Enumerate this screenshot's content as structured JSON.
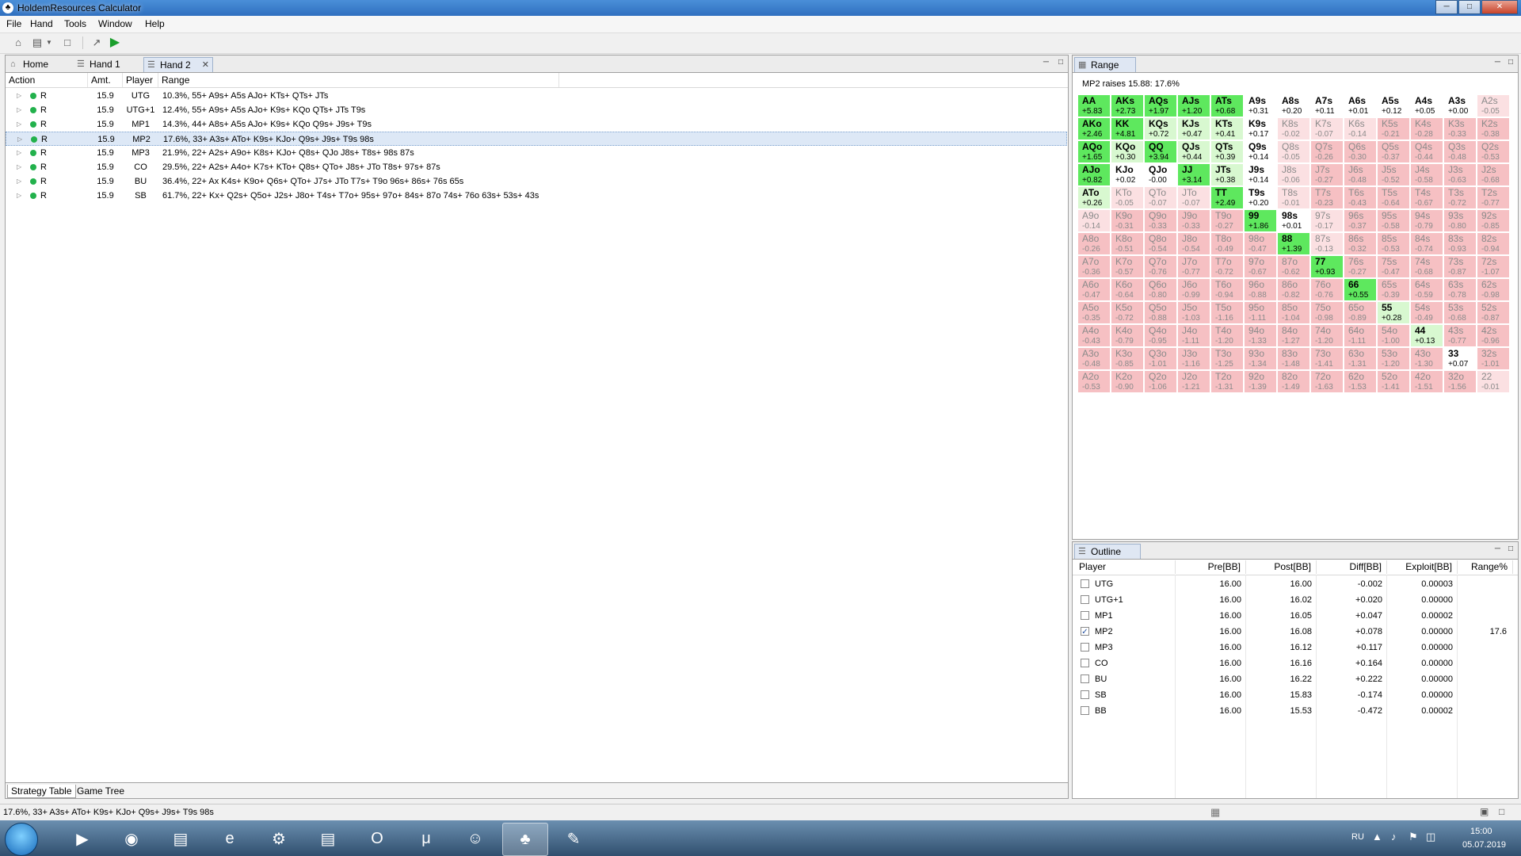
{
  "window": {
    "title": "HoldemResources Calculator"
  },
  "menu": [
    "File",
    "Hand",
    "Tools",
    "Window",
    "Help"
  ],
  "colors": {
    "selected_row": "#dde8f6",
    "green_strong": "#5ee85e",
    "green_light": "#d8f8d0",
    "red": "#f6c0c3",
    "pink_light": "#fbe0e2",
    "status_dot": "#22b14c"
  },
  "tabs": {
    "home": "Home",
    "hand1": "Hand 1",
    "hand2": "Hand 2"
  },
  "strategy": {
    "headers": [
      "Action",
      "Amt.",
      "Player",
      "Range"
    ],
    "rows": [
      {
        "action": "R",
        "amt": "15.9",
        "player": "UTG",
        "range": "10.3%, 55+ A9s+ A5s AJo+ KTs+ QTs+ JTs"
      },
      {
        "action": "R",
        "amt": "15.9",
        "player": "UTG+1",
        "range": "12.4%, 55+ A9s+ A5s AJo+ K9s+ KQo QTs+ JTs T9s"
      },
      {
        "action": "R",
        "amt": "15.9",
        "player": "MP1",
        "range": "14.3%, 44+ A8s+ A5s AJo+ K9s+ KQo Q9s+ J9s+ T9s"
      },
      {
        "action": "R",
        "amt": "15.9",
        "player": "MP2",
        "range": "17.6%, 33+ A3s+ ATo+ K9s+ KJo+ Q9s+ J9s+ T9s 98s"
      },
      {
        "action": "R",
        "amt": "15.9",
        "player": "MP3",
        "range": "21.9%, 22+ A2s+ A9o+ K8s+ KJo+ Q8s+ QJo J8s+ T8s+ 98s 87s"
      },
      {
        "action": "R",
        "amt": "15.9",
        "player": "CO",
        "range": "29.5%, 22+ A2s+ A4o+ K7s+ KTo+ Q8s+ QTo+ J8s+ JTo T8s+ 97s+ 87s"
      },
      {
        "action": "R",
        "amt": "15.9",
        "player": "BU",
        "range": "36.4%, 22+ Ax K4s+ K9o+ Q6s+ QTo+ J7s+ JTo T7s+ T9o 96s+ 86s+ 76s 65s"
      },
      {
        "action": "R",
        "amt": "15.9",
        "player": "SB",
        "range": "61.7%, 22+ Kx+ Q2s+ Q5o+ J2s+ J8o+ T4s+ T7o+ 95s+ 97o+ 84s+ 87o 74s+ 76o 63s+ 53s+ 43s"
      }
    ],
    "bottom_tabs": [
      "Strategy Table",
      "Game Tree"
    ]
  },
  "range_panel": {
    "tab": "Range",
    "info": "MP2 raises 15.88: 17.6%",
    "grid": [
      [
        [
          "AA",
          "+5.83",
          "G"
        ],
        [
          "AKs",
          "+2.73",
          "G"
        ],
        [
          "AQs",
          "+1.97",
          "G"
        ],
        [
          "AJs",
          "+1.20",
          "G"
        ],
        [
          "ATs",
          "+0.68",
          "G"
        ],
        [
          "A9s",
          "+0.31",
          "W"
        ],
        [
          "A8s",
          "+0.20",
          "W"
        ],
        [
          "A7s",
          "+0.11",
          "W"
        ],
        [
          "A6s",
          "+0.01",
          "W"
        ],
        [
          "A5s",
          "+0.12",
          "W"
        ],
        [
          "A4s",
          "+0.05",
          "W"
        ],
        [
          "A3s",
          "+0.00",
          "W"
        ],
        [
          "A2s",
          "-0.05",
          "P"
        ]
      ],
      [
        [
          "AKo",
          "+2.46",
          "G"
        ],
        [
          "KK",
          "+4.81",
          "G"
        ],
        [
          "KQs",
          "+0.72",
          "L"
        ],
        [
          "KJs",
          "+0.47",
          "L"
        ],
        [
          "KTs",
          "+0.41",
          "L"
        ],
        [
          "K9s",
          "+0.17",
          "W"
        ],
        [
          "K8s",
          "-0.02",
          "P"
        ],
        [
          "K7s",
          "-0.07",
          "P"
        ],
        [
          "K6s",
          "-0.14",
          "P"
        ],
        [
          "K5s",
          "-0.21",
          "R"
        ],
        [
          "K4s",
          "-0.28",
          "R"
        ],
        [
          "K3s",
          "-0.33",
          "R"
        ],
        [
          "K2s",
          "-0.38",
          "R"
        ]
      ],
      [
        [
          "AQo",
          "+1.65",
          "G"
        ],
        [
          "KQo",
          "+0.30",
          "L"
        ],
        [
          "QQ",
          "+3.94",
          "G"
        ],
        [
          "QJs",
          "+0.44",
          "L"
        ],
        [
          "QTs",
          "+0.39",
          "L"
        ],
        [
          "Q9s",
          "+0.14",
          "W"
        ],
        [
          "Q8s",
          "-0.05",
          "P"
        ],
        [
          "Q7s",
          "-0.26",
          "R"
        ],
        [
          "Q6s",
          "-0.30",
          "R"
        ],
        [
          "Q5s",
          "-0.37",
          "R"
        ],
        [
          "Q4s",
          "-0.44",
          "R"
        ],
        [
          "Q3s",
          "-0.48",
          "R"
        ],
        [
          "Q2s",
          "-0.53",
          "R"
        ]
      ],
      [
        [
          "AJo",
          "+0.82",
          "G"
        ],
        [
          "KJo",
          "+0.02",
          "W"
        ],
        [
          "QJo",
          "-0.00",
          "W"
        ],
        [
          "JJ",
          "+3.14",
          "G"
        ],
        [
          "JTs",
          "+0.38",
          "L"
        ],
        [
          "J9s",
          "+0.14",
          "W"
        ],
        [
          "J8s",
          "-0.06",
          "P"
        ],
        [
          "J7s",
          "-0.27",
          "R"
        ],
        [
          "J6s",
          "-0.48",
          "R"
        ],
        [
          "J5s",
          "-0.52",
          "R"
        ],
        [
          "J4s",
          "-0.58",
          "R"
        ],
        [
          "J3s",
          "-0.63",
          "R"
        ],
        [
          "J2s",
          "-0.68",
          "R"
        ]
      ],
      [
        [
          "ATo",
          "+0.26",
          "L"
        ],
        [
          "KTo",
          "-0.05",
          "P"
        ],
        [
          "QTo",
          "-0.07",
          "P"
        ],
        [
          "JTo",
          "-0.07",
          "P"
        ],
        [
          "TT",
          "+2.49",
          "G"
        ],
        [
          "T9s",
          "+0.20",
          "W"
        ],
        [
          "T8s",
          "-0.01",
          "P"
        ],
        [
          "T7s",
          "-0.23",
          "R"
        ],
        [
          "T6s",
          "-0.43",
          "R"
        ],
        [
          "T5s",
          "-0.64",
          "R"
        ],
        [
          "T4s",
          "-0.67",
          "R"
        ],
        [
          "T3s",
          "-0.72",
          "R"
        ],
        [
          "T2s",
          "-0.77",
          "R"
        ]
      ],
      [
        [
          "A9o",
          "-0.14",
          "P"
        ],
        [
          "K9o",
          "-0.31",
          "R"
        ],
        [
          "Q9o",
          "-0.33",
          "R"
        ],
        [
          "J9o",
          "-0.33",
          "R"
        ],
        [
          "T9o",
          "-0.27",
          "R"
        ],
        [
          "99",
          "+1.86",
          "G"
        ],
        [
          "98s",
          "+0.01",
          "W"
        ],
        [
          "97s",
          "-0.17",
          "P"
        ],
        [
          "96s",
          "-0.37",
          "R"
        ],
        [
          "95s",
          "-0.58",
          "R"
        ],
        [
          "94s",
          "-0.79",
          "R"
        ],
        [
          "93s",
          "-0.80",
          "R"
        ],
        [
          "92s",
          "-0.85",
          "R"
        ]
      ],
      [
        [
          "A8o",
          "-0.26",
          "R"
        ],
        [
          "K8o",
          "-0.51",
          "R"
        ],
        [
          "Q8o",
          "-0.54",
          "R"
        ],
        [
          "J8o",
          "-0.54",
          "R"
        ],
        [
          "T8o",
          "-0.49",
          "R"
        ],
        [
          "98o",
          "-0.47",
          "R"
        ],
        [
          "88",
          "+1.39",
          "G"
        ],
        [
          "87s",
          "-0.13",
          "P"
        ],
        [
          "86s",
          "-0.32",
          "R"
        ],
        [
          "85s",
          "-0.53",
          "R"
        ],
        [
          "84s",
          "-0.74",
          "R"
        ],
        [
          "83s",
          "-0.93",
          "R"
        ],
        [
          "82s",
          "-0.94",
          "R"
        ]
      ],
      [
        [
          "A7o",
          "-0.36",
          "R"
        ],
        [
          "K7o",
          "-0.57",
          "R"
        ],
        [
          "Q7o",
          "-0.76",
          "R"
        ],
        [
          "J7o",
          "-0.77",
          "R"
        ],
        [
          "T7o",
          "-0.72",
          "R"
        ],
        [
          "97o",
          "-0.67",
          "R"
        ],
        [
          "87o",
          "-0.62",
          "R"
        ],
        [
          "77",
          "+0.93",
          "G"
        ],
        [
          "76s",
          "-0.27",
          "R"
        ],
        [
          "75s",
          "-0.47",
          "R"
        ],
        [
          "74s",
          "-0.68",
          "R"
        ],
        [
          "73s",
          "-0.87",
          "R"
        ],
        [
          "72s",
          "-1.07",
          "R"
        ]
      ],
      [
        [
          "A6o",
          "-0.47",
          "R"
        ],
        [
          "K6o",
          "-0.64",
          "R"
        ],
        [
          "Q6o",
          "-0.80",
          "R"
        ],
        [
          "J6o",
          "-0.99",
          "R"
        ],
        [
          "T6o",
          "-0.94",
          "R"
        ],
        [
          "96o",
          "-0.88",
          "R"
        ],
        [
          "86o",
          "-0.82",
          "R"
        ],
        [
          "76o",
          "-0.76",
          "R"
        ],
        [
          "66",
          "+0.55",
          "G"
        ],
        [
          "65s",
          "-0.39",
          "R"
        ],
        [
          "64s",
          "-0.59",
          "R"
        ],
        [
          "63s",
          "-0.78",
          "R"
        ],
        [
          "62s",
          "-0.98",
          "R"
        ]
      ],
      [
        [
          "A5o",
          "-0.35",
          "R"
        ],
        [
          "K5o",
          "-0.72",
          "R"
        ],
        [
          "Q5o",
          "-0.88",
          "R"
        ],
        [
          "J5o",
          "-1.03",
          "R"
        ],
        [
          "T5o",
          "-1.16",
          "R"
        ],
        [
          "95o",
          "-1.11",
          "R"
        ],
        [
          "85o",
          "-1.04",
          "R"
        ],
        [
          "75o",
          "-0.98",
          "R"
        ],
        [
          "65o",
          "-0.89",
          "R"
        ],
        [
          "55",
          "+0.28",
          "L"
        ],
        [
          "54s",
          "-0.49",
          "R"
        ],
        [
          "53s",
          "-0.68",
          "R"
        ],
        [
          "52s",
          "-0.87",
          "R"
        ]
      ],
      [
        [
          "A4o",
          "-0.43",
          "R"
        ],
        [
          "K4o",
          "-0.79",
          "R"
        ],
        [
          "Q4o",
          "-0.95",
          "R"
        ],
        [
          "J4o",
          "-1.11",
          "R"
        ],
        [
          "T4o",
          "-1.20",
          "R"
        ],
        [
          "94o",
          "-1.33",
          "R"
        ],
        [
          "84o",
          "-1.27",
          "R"
        ],
        [
          "74o",
          "-1.20",
          "R"
        ],
        [
          "64o",
          "-1.11",
          "R"
        ],
        [
          "54o",
          "-1.00",
          "R"
        ],
        [
          "44",
          "+0.13",
          "L"
        ],
        [
          "43s",
          "-0.77",
          "R"
        ],
        [
          "42s",
          "-0.96",
          "R"
        ]
      ],
      [
        [
          "A3o",
          "-0.48",
          "R"
        ],
        [
          "K3o",
          "-0.85",
          "R"
        ],
        [
          "Q3o",
          "-1.01",
          "R"
        ],
        [
          "J3o",
          "-1.16",
          "R"
        ],
        [
          "T3o",
          "-1.25",
          "R"
        ],
        [
          "93o",
          "-1.34",
          "R"
        ],
        [
          "83o",
          "-1.48",
          "R"
        ],
        [
          "73o",
          "-1.41",
          "R"
        ],
        [
          "63o",
          "-1.31",
          "R"
        ],
        [
          "53o",
          "-1.20",
          "R"
        ],
        [
          "43o",
          "-1.30",
          "R"
        ],
        [
          "33",
          "+0.07",
          "W"
        ],
        [
          "32s",
          "-1.01",
          "R"
        ]
      ],
      [
        [
          "A2o",
          "-0.53",
          "R"
        ],
        [
          "K2o",
          "-0.90",
          "R"
        ],
        [
          "Q2o",
          "-1.06",
          "R"
        ],
        [
          "J2o",
          "-1.21",
          "R"
        ],
        [
          "T2o",
          "-1.31",
          "R"
        ],
        [
          "92o",
          "-1.39",
          "R"
        ],
        [
          "82o",
          "-1.49",
          "R"
        ],
        [
          "72o",
          "-1.63",
          "R"
        ],
        [
          "62o",
          "-1.53",
          "R"
        ],
        [
          "52o",
          "-1.41",
          "R"
        ],
        [
          "42o",
          "-1.51",
          "R"
        ],
        [
          "32o",
          "-1.56",
          "R"
        ],
        [
          "22",
          "-0.01",
          "P"
        ]
      ]
    ]
  },
  "outline": {
    "tab": "Outline",
    "headers": [
      "Player",
      "Pre[BB]",
      "Post[BB]",
      "Diff[BB]",
      "Exploit[BB]",
      "Range%"
    ],
    "rows": [
      {
        "player": "UTG",
        "pre": "16.00",
        "post": "16.00",
        "diff": "-0.002",
        "exploit": "0.00003",
        "range": "",
        "checked": false
      },
      {
        "player": "UTG+1",
        "pre": "16.00",
        "post": "16.02",
        "diff": "+0.020",
        "exploit": "0.00000",
        "range": "",
        "checked": false
      },
      {
        "player": "MP1",
        "pre": "16.00",
        "post": "16.05",
        "diff": "+0.047",
        "exploit": "0.00002",
        "range": "",
        "checked": false
      },
      {
        "player": "MP2",
        "pre": "16.00",
        "post": "16.08",
        "diff": "+0.078",
        "exploit": "0.00000",
        "range": "17.6",
        "checked": true
      },
      {
        "player": "MP3",
        "pre": "16.00",
        "post": "16.12",
        "diff": "+0.117",
        "exploit": "0.00000",
        "range": "",
        "checked": false
      },
      {
        "player": "CO",
        "pre": "16.00",
        "post": "16.16",
        "diff": "+0.164",
        "exploit": "0.00000",
        "range": "",
        "checked": false
      },
      {
        "player": "BU",
        "pre": "16.00",
        "post": "16.22",
        "diff": "+0.222",
        "exploit": "0.00000",
        "range": "",
        "checked": false
      },
      {
        "player": "SB",
        "pre": "16.00",
        "post": "15.83",
        "diff": "-0.174",
        "exploit": "0.00000",
        "range": "",
        "checked": false
      },
      {
        "player": "BB",
        "pre": "16.00",
        "post": "15.53",
        "diff": "-0.472",
        "exploit": "0.00002",
        "range": "",
        "checked": false
      }
    ]
  },
  "status": {
    "text": "17.6%, 33+ A3s+ ATo+ K9s+ KJo+ Q9s+ J9s+ T9s 98s"
  },
  "taskbar": {
    "lang": "RU",
    "time": "15:00",
    "date": "05.07.2019",
    "apps": [
      "media-player-icon",
      "chrome-icon",
      "explorer-icon",
      "ie-icon",
      "settings-app-icon",
      "notepad-icon",
      "opera-icon",
      "utorrent-icon",
      "discord-icon",
      "holdem-icon",
      "paint-icon"
    ]
  }
}
